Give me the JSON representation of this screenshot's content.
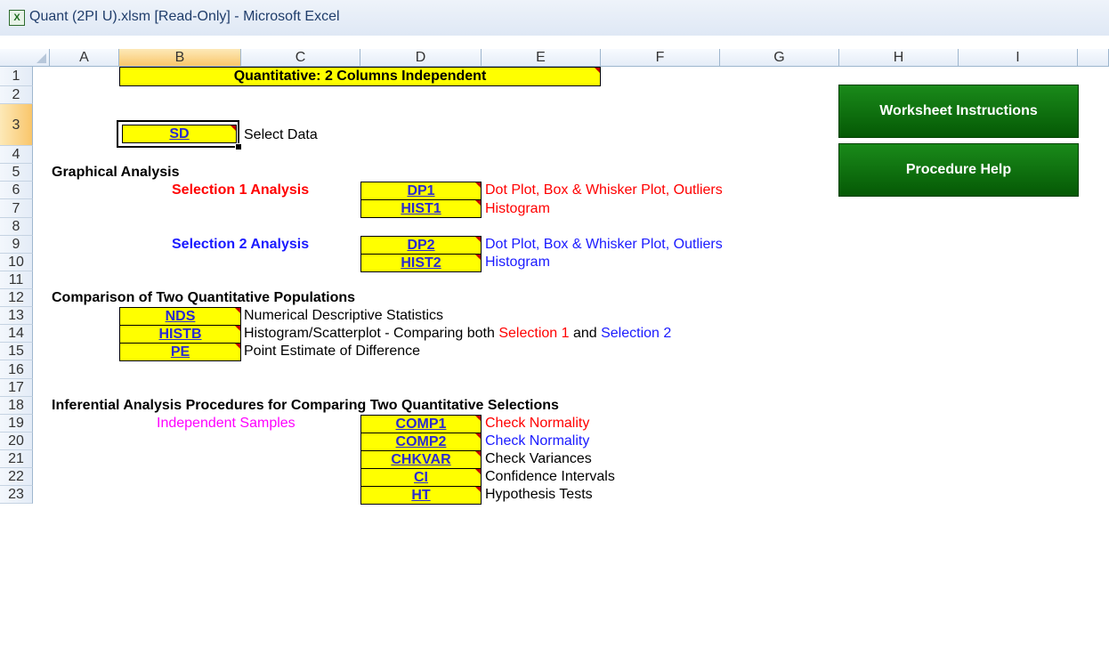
{
  "window": {
    "title": "Quant (2PI U).xlsm  [Read-Only] - Microsoft Excel"
  },
  "columns": [
    "A",
    "B",
    "C",
    "D",
    "E",
    "F",
    "G",
    "H",
    "I"
  ],
  "rows": [
    "1",
    "2",
    "3",
    "4",
    "5",
    "6",
    "7",
    "8",
    "9",
    "10",
    "11",
    "12",
    "13",
    "14",
    "15",
    "16",
    "17",
    "18",
    "19",
    "20",
    "21",
    "22",
    "23"
  ],
  "selected_cell": "B3",
  "sheet": {
    "title": "Quantitative:  2 Columns Independent",
    "select_data": {
      "button": "SD",
      "label": "Select Data"
    },
    "graphical": {
      "heading": "Graphical Analysis",
      "sel1": {
        "label": "Selection 1 Analysis",
        "dp_button": "DP1",
        "dp_desc": "Dot Plot, Box & Whisker Plot, Outliers",
        "hist_button": "HIST1",
        "hist_desc": "Histogram"
      },
      "sel2": {
        "label": "Selection 2 Analysis",
        "dp_button": "DP2",
        "dp_desc": "Dot Plot, Box & Whisker Plot, Outliers",
        "hist_button": "HIST2",
        "hist_desc": "Histogram"
      }
    },
    "comparison": {
      "heading": "Comparison of Two Quantitative Populations",
      "nds": {
        "button": "NDS",
        "desc": "Numerical Descriptive Statistics"
      },
      "histb": {
        "button": "HISTB",
        "desc_prefix": "Histogram/Scatterplot - Comparing both ",
        "sel1": "Selection 1",
        "and": " and ",
        "sel2": "Selection 2"
      },
      "pe": {
        "button": "PE",
        "desc": "Point Estimate of Difference"
      }
    },
    "inferential": {
      "heading": "Inferential Analysis Procedures for Comparing Two Quantitative Selections",
      "label": "Independent Samples",
      "comp1": {
        "button": "COMP1",
        "desc": "Check Normality"
      },
      "comp2": {
        "button": "COMP2",
        "desc": "Check Normality"
      },
      "chkvar": {
        "button": "CHKVAR",
        "desc": "Check Variances"
      },
      "ci": {
        "button": "CI",
        "desc": "Confidence Intervals"
      },
      "ht": {
        "button": "HT",
        "desc": "Hypothesis Tests"
      }
    },
    "worksheet_instructions": "Worksheet Instructions",
    "procedure_help": "Procedure Help"
  },
  "colors": {
    "red": "#ff0000",
    "blue": "#1a1aff",
    "magenta": "#ff00ff",
    "button_yellow": "#ffff00",
    "button_green": "#0a6e0a"
  }
}
